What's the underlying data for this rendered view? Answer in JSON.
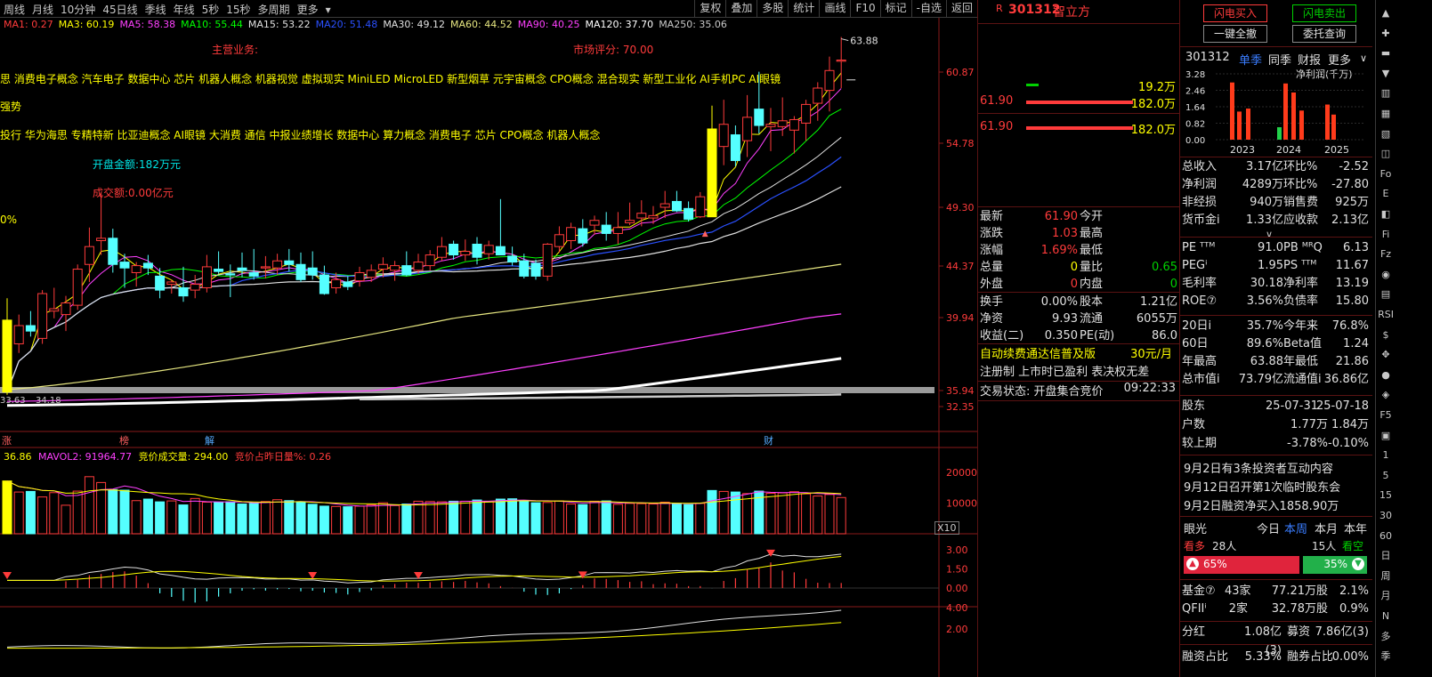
{
  "periods": [
    "周线",
    "月线",
    "10分钟",
    "45日线",
    "季线",
    "年线",
    "5秒",
    "15秒",
    "多周期",
    "更多"
  ],
  "toolbar": [
    "复权",
    "叠加",
    "多股",
    "统计",
    "画线",
    "F10",
    "标记",
    "-自选",
    "返回"
  ],
  "ma": [
    {
      "label": "MA1: 0.27",
      "color": "#ff3b3b"
    },
    {
      "label": "MA3: 60.19",
      "color": "#ffff00"
    },
    {
      "label": "MA5: 58.38",
      "color": "#ff40ff"
    },
    {
      "label": "MA10: 55.44",
      "color": "#00ff00"
    },
    {
      "label": "MA15: 53.22",
      "color": "#e0e0e0"
    },
    {
      "label": "MA20: 51.48",
      "color": "#2a50ff"
    },
    {
      "label": "MA30: 49.12",
      "color": "#e0e0e0"
    },
    {
      "label": "MA60: 44.52",
      "color": "#e6e680"
    },
    {
      "label": "MA90: 40.25",
      "color": "#ff40ff"
    },
    {
      "label": "MA120: 37.70",
      "color": "#ffffff"
    },
    {
      "label": "MA250: 35.06",
      "color": "#c8c8c8"
    }
  ],
  "chart": {
    "main_business": "主营业务:",
    "market_score": "市场评分: 70.00",
    "concepts": [
      "思 消费电子概念 汽车电子 数据中心 芯片 机器人概念 机器视觉 虚拟现实 MiniLED MicroLED 新型烟草 元宇宙概念 CPO概念 混合现实 新型工业化 AI手机PC AI眼镜",
      "强势",
      "投行 华为海思 专精特新 比亚迪概念 AI眼镜 大消费 通信 中报业绩增长 数据中心 算力概念 消费电子 芯片 CPO概念 机器人概念"
    ],
    "open_amount": "开盘金额:182万元",
    "turnover_amount": "成交额:0.00亿元",
    "pct": "0%",
    "high_label": "63.88",
    "low_label_a": "33.63",
    "low_label_b": "34.18",
    "event_marks": [
      "涨",
      "榜",
      "解",
      "财"
    ]
  },
  "chart_data": {
    "type": "candlestick",
    "y_ticks": [
      "60.87",
      "54.78",
      "49.30",
      "44.37",
      "39.94",
      "35.94",
      "32.35"
    ],
    "candles": [
      {
        "o": 39.8,
        "h": 41.6,
        "l": 35.0,
        "c": 35.6
      },
      {
        "o": 38.5,
        "h": 40.2,
        "l": 38.0,
        "c": 39.5
      },
      {
        "o": 39.5,
        "h": 40.5,
        "l": 38.9,
        "c": 39.2
      },
      {
        "o": 38.8,
        "h": 42.3,
        "l": 38.5,
        "c": 42.0
      },
      {
        "o": 40.5,
        "h": 42.5,
        "l": 39.9,
        "c": 40.7
      },
      {
        "o": 40.2,
        "h": 41.8,
        "l": 39.2,
        "c": 41.2
      },
      {
        "o": 41.0,
        "h": 44.5,
        "l": 40.6,
        "c": 44.1
      },
      {
        "o": 44.5,
        "h": 47.6,
        "l": 43.0,
        "c": 46.0
      },
      {
        "o": 46.5,
        "h": 50.5,
        "l": 45.3,
        "c": 46.7
      },
      {
        "o": 46.7,
        "h": 47.5,
        "l": 43.8,
        "c": 44.5
      },
      {
        "o": 44.7,
        "h": 45.4,
        "l": 42.5,
        "c": 44.2
      },
      {
        "o": 43.8,
        "h": 44.7,
        "l": 42.6,
        "c": 44.4
      },
      {
        "o": 44.6,
        "h": 45.3,
        "l": 43.6,
        "c": 44.2
      },
      {
        "o": 43.5,
        "h": 44.2,
        "l": 41.6,
        "c": 42.3
      },
      {
        "o": 42.8,
        "h": 43.2,
        "l": 42.0,
        "c": 43.0
      },
      {
        "o": 42.5,
        "h": 44.3,
        "l": 41.3,
        "c": 41.8
      },
      {
        "o": 42.3,
        "h": 43.6,
        "l": 41.6,
        "c": 42.8
      },
      {
        "o": 42.5,
        "h": 45.3,
        "l": 42.1,
        "c": 44.3
      },
      {
        "o": 44.1,
        "h": 45.6,
        "l": 43.7,
        "c": 43.9
      },
      {
        "o": 43.7,
        "h": 44.5,
        "l": 41.7,
        "c": 43.6
      },
      {
        "o": 44.2,
        "h": 45.5,
        "l": 43.4,
        "c": 44.0
      },
      {
        "o": 43.8,
        "h": 45.8,
        "l": 43.2,
        "c": 43.5
      },
      {
        "o": 44.2,
        "h": 45.2,
        "l": 43.3,
        "c": 44.3
      },
      {
        "o": 44.2,
        "h": 45.4,
        "l": 43.6,
        "c": 44.8
      },
      {
        "o": 44.8,
        "h": 45.8,
        "l": 43.9,
        "c": 44.5
      },
      {
        "o": 44.5,
        "h": 45.5,
        "l": 43.0,
        "c": 43.2
      },
      {
        "o": 44.2,
        "h": 45.6,
        "l": 43.2,
        "c": 43.6
      },
      {
        "o": 43.6,
        "h": 44.4,
        "l": 41.9,
        "c": 42.0
      },
      {
        "o": 42.5,
        "h": 43.8,
        "l": 42.0,
        "c": 43.2
      },
      {
        "o": 43.0,
        "h": 43.5,
        "l": 42.3,
        "c": 42.6
      },
      {
        "o": 43.1,
        "h": 44.3,
        "l": 42.6,
        "c": 43.8
      },
      {
        "o": 43.4,
        "h": 44.5,
        "l": 43.0,
        "c": 44.0
      },
      {
        "o": 44.1,
        "h": 45.1,
        "l": 43.4,
        "c": 44.5
      },
      {
        "o": 44.0,
        "h": 44.8,
        "l": 43.1,
        "c": 44.4
      },
      {
        "o": 44.4,
        "h": 45.6,
        "l": 43.5,
        "c": 43.6
      },
      {
        "o": 44.0,
        "h": 45.4,
        "l": 43.7,
        "c": 44.7
      },
      {
        "o": 44.4,
        "h": 45.7,
        "l": 44.0,
        "c": 45.3
      },
      {
        "o": 45.1,
        "h": 46.8,
        "l": 44.8,
        "c": 46.0
      },
      {
        "o": 46.2,
        "h": 46.5,
        "l": 44.9,
        "c": 45.3
      },
      {
        "o": 45.3,
        "h": 46.6,
        "l": 44.8,
        "c": 45.6
      },
      {
        "o": 46.2,
        "h": 46.8,
        "l": 44.5,
        "c": 45.1
      },
      {
        "o": 45.4,
        "h": 46.5,
        "l": 44.9,
        "c": 46.1
      },
      {
        "o": 46.0,
        "h": 50.0,
        "l": 45.5,
        "c": 45.3
      },
      {
        "o": 45.2,
        "h": 46.0,
        "l": 44.4,
        "c": 44.7
      },
      {
        "o": 44.8,
        "h": 45.4,
        "l": 43.3,
        "c": 43.5
      },
      {
        "o": 44.6,
        "h": 44.9,
        "l": 43.2,
        "c": 43.5
      },
      {
        "o": 43.5,
        "h": 46.3,
        "l": 43.1,
        "c": 46.2
      },
      {
        "o": 46.0,
        "h": 47.7,
        "l": 45.5,
        "c": 47.0
      },
      {
        "o": 46.5,
        "h": 48.0,
        "l": 45.8,
        "c": 47.6
      },
      {
        "o": 47.5,
        "h": 48.3,
        "l": 46.0,
        "c": 46.3
      },
      {
        "o": 47.8,
        "h": 48.6,
        "l": 47.0,
        "c": 48.2
      },
      {
        "o": 47.8,
        "h": 48.9,
        "l": 46.5,
        "c": 47.1
      },
      {
        "o": 47.1,
        "h": 48.9,
        "l": 46.2,
        "c": 47.6
      },
      {
        "o": 48.0,
        "h": 49.7,
        "l": 47.8,
        "c": 48.2
      },
      {
        "o": 48.4,
        "h": 49.9,
        "l": 47.7,
        "c": 48.8
      },
      {
        "o": 48.4,
        "h": 49.4,
        "l": 47.9,
        "c": 48.6
      },
      {
        "o": 49.3,
        "h": 50.7,
        "l": 48.4,
        "c": 49.6
      },
      {
        "o": 49.8,
        "h": 50.7,
        "l": 48.9,
        "c": 49.0
      },
      {
        "o": 49.2,
        "h": 49.8,
        "l": 48.1,
        "c": 48.3
      },
      {
        "o": 48.5,
        "h": 50.6,
        "l": 48.4,
        "c": 50.2
      },
      {
        "o": 56.0,
        "h": 58.0,
        "l": 48.5,
        "c": 48.5
      },
      {
        "o": 54.5,
        "h": 58.5,
        "l": 52.9,
        "c": 56.4
      },
      {
        "o": 55.5,
        "h": 56.3,
        "l": 52.8,
        "c": 53.3
      },
      {
        "o": 55.0,
        "h": 58.9,
        "l": 53.6,
        "c": 57.0
      },
      {
        "o": 57.7,
        "h": 60.9,
        "l": 55.6,
        "c": 56.3
      },
      {
        "o": 56.2,
        "h": 57.8,
        "l": 54.1,
        "c": 56.4
      },
      {
        "o": 56.2,
        "h": 58.7,
        "l": 55.4,
        "c": 56.7
      },
      {
        "o": 55.9,
        "h": 57.1,
        "l": 53.9,
        "c": 56.8
      },
      {
        "o": 56.5,
        "h": 58.5,
        "l": 55.0,
        "c": 58.1
      },
      {
        "o": 58.2,
        "h": 60.0,
        "l": 56.7,
        "c": 59.5
      },
      {
        "o": 59.3,
        "h": 62.2,
        "l": 57.5,
        "c": 61.0
      },
      {
        "o": 61.8,
        "h": 63.88,
        "l": 59.5,
        "c": 61.9
      }
    ],
    "vol_ticks": [
      "20000",
      "10000"
    ],
    "volumes": [
      17200,
      13600,
      13800,
      12000,
      13400,
      9300,
      13900,
      18600,
      16700,
      14400,
      14200,
      10800,
      11300,
      10400,
      10700,
      9400,
      11500,
      10300,
      10200,
      10400,
      9700,
      9900,
      10500,
      11100,
      10800,
      10200,
      9600,
      9000,
      8900,
      8800,
      9000,
      9400,
      10100,
      9200,
      9700,
      10600,
      10500,
      10400,
      10600,
      10600,
      11000,
      10500,
      11300,
      11400,
      10700,
      10100,
      10200,
      10700,
      9700,
      9500,
      10600,
      10700,
      9600,
      9900,
      9800,
      9700,
      10300,
      9900,
      9500,
      9900,
      14100,
      13800,
      13600,
      13100,
      13900,
      13200,
      13300,
      13700,
      13000,
      12300,
      12800,
      11800
    ],
    "ind1_ticks": [
      "3.00",
      "1.50",
      "0.00"
    ],
    "ind2_ticks": [
      "4.00",
      "2.00"
    ]
  },
  "vol_header": {
    "vol": "36.86",
    "mavol2": "MAVOL2: 91964.77",
    "bid": "竞价成交量: 294.00",
    "ratio": "竞价占昨日量%: 0.26"
  },
  "x10": "X10",
  "stock": {
    "flag": "R",
    "code": "301312",
    "name": "智立方"
  },
  "orderbook": {
    "r1v": "19.2万",
    "r2p": "61.90",
    "r2v": "182.0万",
    "r3p": "61.90",
    "r3v": "182.0万"
  },
  "quote": {
    "rows": [
      {
        "l1": "最新",
        "v1": "61.90",
        "c1": "#ff3b3b",
        "l2": "今开",
        "v2": "",
        "c2": "#ff3b3b"
      },
      {
        "l1": "涨跌",
        "v1": "1.03",
        "c1": "#ff3b3b",
        "l2": "最高",
        "v2": "",
        "c2": "#ff3b3b"
      },
      {
        "l1": "涨幅",
        "v1": "1.69%",
        "c1": "#ff3b3b",
        "l2": "最低",
        "v2": "",
        "c2": "#ff3b3b"
      },
      {
        "l1": "总量",
        "v1": "0",
        "c1": "#ffff00",
        "l2": "量比",
        "v2": "0.65",
        "c2": "#00d000"
      },
      {
        "l1": "外盘",
        "v1": "0",
        "c1": "#ff3b3b",
        "l2": "内盘",
        "v2": "0",
        "c2": "#00d000"
      }
    ],
    "rows2": [
      {
        "l1": "换手",
        "v1": "0.00%",
        "l2": "股本",
        "v2": "1.21亿"
      },
      {
        "l1": "净资",
        "v1": "9.93",
        "l2": "流通",
        "v2": "6055万"
      },
      {
        "l1": "收益(二)",
        "v1": "0.350",
        "l2": "PE(动)",
        "v2": "86.0"
      }
    ],
    "promo": "自动续费通达信普及版",
    "promo_price": "30元/月",
    "reg_note": "注册制 上市时已盈利 表决权无差",
    "status_label": "交易状态: 开盘集合竞价",
    "status_time": "09:22:33"
  },
  "actions": {
    "flash_buy": "闪电买入",
    "flash_sell": "闪电卖出",
    "cancel_all": "一键全撤",
    "order_query": "委托查询"
  },
  "fin_tabs": {
    "code": "301312",
    "t1": "单季",
    "t2": "同季",
    "t3": "财报",
    "t4": "更多"
  },
  "mini": {
    "title": "净利润(千万)",
    "yticks": [
      "3.28",
      "2.46",
      "1.64",
      "0.82",
      "0.00"
    ],
    "years": [
      "2023",
      "2024",
      "2025"
    ],
    "bars": [
      {
        "v": 2.85,
        "neg": false
      },
      {
        "v": 1.4,
        "neg": false
      },
      {
        "v": 1.55,
        "neg": false
      },
      {
        "v": 0.62,
        "neg": true
      },
      {
        "v": 2.8,
        "neg": false
      },
      {
        "v": 2.35,
        "neg": false
      },
      {
        "v": 1.45,
        "neg": false
      },
      {
        "v": 1.75,
        "neg": false
      },
      {
        "v": 1.25,
        "neg": false
      }
    ]
  },
  "fin1": [
    {
      "l1": "总收入",
      "v1": "3.17亿",
      "l2": "环比%",
      "v2": "-2.52"
    },
    {
      "l1": "净利润",
      "v1": "4289万",
      "l2": "环比%",
      "v2": "-27.80"
    },
    {
      "l1": "非经损",
      "v1": "940万",
      "l2": "销售费",
      "v2": "925万"
    },
    {
      "l1": "货币金i",
      "v1": "1.33亿",
      "l2": "应收款",
      "v2": "2.13亿"
    }
  ],
  "fin_chev": "∨",
  "fin2": [
    {
      "l1": "PE ᵀᵀᴹ",
      "v1": "91.0",
      "l2": "PB ᴹᴿQ",
      "v2": "6.13"
    },
    {
      "l1": "PEGⁱ",
      "v1": "1.95",
      "l2": "PS ᵀᵀᴹ",
      "v2": "11.67"
    },
    {
      "l1": "毛利率",
      "v1": "30.18",
      "l2": "净利率",
      "v2": "13.19"
    },
    {
      "l1": "ROE⑦",
      "v1": "3.56%",
      "l2": "负债率",
      "v2": "15.80"
    }
  ],
  "fin3": [
    {
      "l1": "20日i",
      "v1": "35.7%",
      "l2": "今年来",
      "v2": "76.8%"
    },
    {
      "l1": "60日",
      "v1": "89.6%",
      "l2": "Beta值",
      "v2": "1.24"
    },
    {
      "l1": "年最高",
      "v1": "63.88",
      "l2": "年最低",
      "v2": "21.86"
    },
    {
      "l1": "总市值i",
      "v1": "73.79亿",
      "l2": "流通值i",
      "v2": "36.86亿"
    }
  ],
  "holders": {
    "label": "股东",
    "d1": "25-07-31",
    "d2": "25-07-18",
    "r2l": "户数",
    "r2a": "1.77万",
    "r2b": "1.84万",
    "r3l": "较上期",
    "r3a": "-3.78%",
    "r3b": "-0.10%"
  },
  "news": [
    "9月2日有3条投资者互动内容",
    "9月12日召开第1次临时股东会",
    "9月2日融资净买入1858.90万"
  ],
  "insight": {
    "label": "眼光",
    "tabs": [
      "今日",
      "本周",
      "本月",
      "本年"
    ],
    "bull": "看多",
    "bull_n": "28人",
    "bear_n": "15人",
    "bear": "看空",
    "bull_pct": "65%",
    "bear_pct": "35%"
  },
  "inst": [
    {
      "l": "基金⑦",
      "a": "43家",
      "b": "77.21万股",
      "c": "2.1%"
    },
    {
      "l": "QFIIⁱ",
      "a": "2家",
      "b": "32.78万股",
      "c": "0.9%"
    }
  ],
  "dividend": {
    "l1": "分红",
    "v1": "1.08亿(3)",
    "l2": "募资",
    "v2": "7.86亿(3)"
  },
  "margin": {
    "l1": "融资占比",
    "v1": "5.33%",
    "l2": "融券占比",
    "v2": "0.00%"
  },
  "tools": [
    {
      "icon": "▲",
      "name": "arrow-up-icon"
    },
    {
      "icon": "✚",
      "name": "plus-icon"
    },
    {
      "icon": "▬",
      "name": "minus-icon"
    },
    {
      "icon": "▼",
      "name": "arrow-down-icon"
    },
    {
      "icon": "▥",
      "name": "bar-chart-icon"
    },
    {
      "icon": "▦",
      "name": "grid-icon"
    },
    {
      "icon": "▧",
      "name": "pattern-icon"
    },
    {
      "icon": "◫",
      "name": "window-icon"
    },
    {
      "icon": "Fo",
      "name": "fo-icon"
    },
    {
      "icon": "E",
      "name": "e-icon"
    },
    {
      "icon": "◧",
      "name": "split-icon"
    },
    {
      "icon": "Fi",
      "name": "fi-icon"
    },
    {
      "icon": "Fz",
      "name": "fz-icon"
    },
    {
      "icon": "◉",
      "name": "target-icon"
    },
    {
      "icon": "▤",
      "name": "list-icon"
    },
    {
      "icon": "RSI",
      "name": "rsi-icon"
    },
    {
      "icon": "$",
      "name": "dollar-icon"
    },
    {
      "icon": "✥",
      "name": "move-icon"
    },
    {
      "icon": "●",
      "name": "dot-icon"
    },
    {
      "icon": "◈",
      "name": "diamond-icon"
    },
    {
      "icon": "F5",
      "name": "f5-icon"
    },
    {
      "icon": "▣",
      "name": "square-icon"
    },
    {
      "icon": "1",
      "name": "text-1"
    },
    {
      "icon": "5",
      "name": "text-5"
    },
    {
      "icon": "15",
      "name": "text-15"
    },
    {
      "icon": "30",
      "name": "text-30"
    },
    {
      "icon": "60",
      "name": "text-60"
    },
    {
      "icon": "日",
      "name": "text-day"
    },
    {
      "icon": "周",
      "name": "text-week"
    },
    {
      "icon": "月",
      "name": "text-month"
    },
    {
      "icon": "N",
      "name": "text-n"
    },
    {
      "icon": "多",
      "name": "text-multi"
    },
    {
      "icon": "季",
      "name": "text-quarter"
    }
  ]
}
